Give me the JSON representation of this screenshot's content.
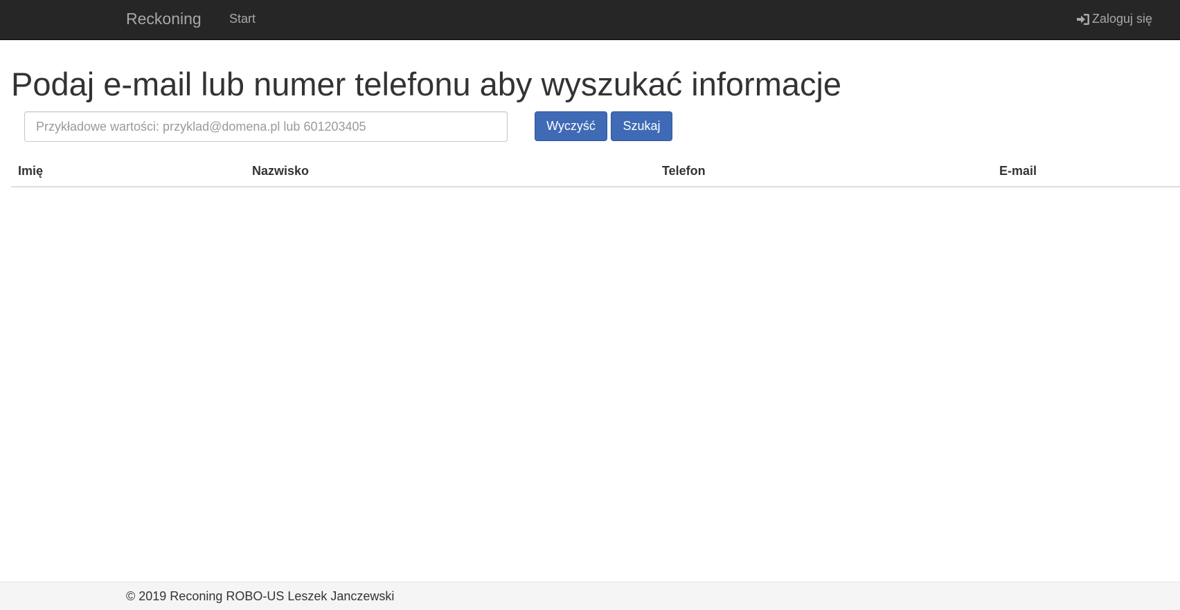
{
  "navbar": {
    "brand": "Reckoning",
    "start_label": "Start",
    "login_label": "Zaloguj się",
    "login_icon": "sign-in-icon"
  },
  "main": {
    "title": "Podaj e-mail lub numer telefonu aby wyszukać informacje",
    "search": {
      "placeholder": "Przykładowe wartości: przyklad@domena.pl lub 601203405",
      "value": ""
    },
    "clear_label": "Wyczyść",
    "search_label": "Szukaj"
  },
  "table": {
    "columns": [
      "Imię",
      "Nazwisko",
      "Telefon",
      "E-mail"
    ],
    "rows": []
  },
  "footer": {
    "text": "© 2019 Reconing ROBO-US Leszek Janczewski"
  },
  "colors": {
    "navbar_bg": "#262626",
    "primary_button": "#3f6ab5",
    "footer_bg": "#f5f5f5"
  }
}
